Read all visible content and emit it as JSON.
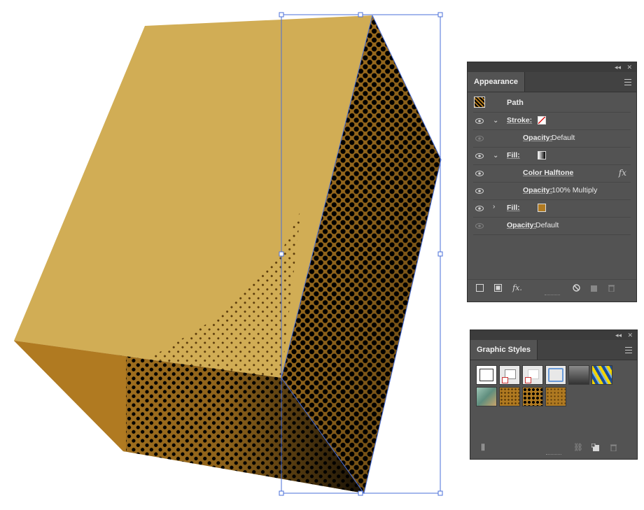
{
  "appearance_panel": {
    "tab": "Appearance",
    "header": "Path",
    "rows": [
      {
        "label": "Stroke:"
      },
      {
        "label": "Opacity:",
        "value": "Default"
      },
      {
        "label": "Fill:"
      },
      {
        "label": "Color Halftone",
        "fx_icon": "fx-icon"
      },
      {
        "label": "Opacity:",
        "value": "100% Multiply"
      },
      {
        "label": "Fill:"
      },
      {
        "label": "Opacity:",
        "value": "Default"
      }
    ],
    "footer_icons": [
      "new-stroke-icon",
      "new-fill-icon",
      "add-effect-icon",
      "clear-appearance-icon",
      "duplicate-item-icon",
      "delete-item-icon"
    ]
  },
  "graphic_styles_panel": {
    "tab": "Graphic Styles",
    "swatches": [
      "default-style",
      "no-fill-style",
      "no-stroke-style",
      "blue-outline-style",
      "gray-gradient-style",
      "pattern-style",
      "green-texture-style",
      "halftone-style-1",
      "halftone-style-2",
      "halftone-style-3"
    ],
    "footer_icons": [
      "libraries-icon",
      "break-link-icon",
      "new-style-icon",
      "delete-style-icon"
    ]
  },
  "colors": {
    "cube_top": "#d1ad55",
    "cube_left": "#b07a21",
    "cube_right": "#b07a21",
    "halftone": "#000000",
    "selection": "#4a6fd8",
    "panel_bg": "#535353"
  }
}
